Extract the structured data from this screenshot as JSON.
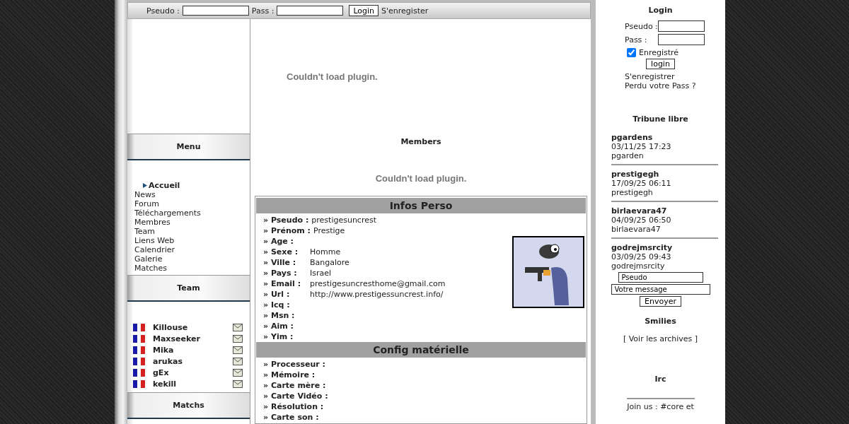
{
  "top_bar": {
    "pseudo_label": "Pseudo :",
    "pass_label": "Pass :",
    "login_button": "Login",
    "register_link": "S'enregister"
  },
  "menu": {
    "title": "Menu",
    "items": [
      {
        "label": "Accueil",
        "selected": true
      },
      {
        "label": "News",
        "selected": false
      },
      {
        "label": "Forum",
        "selected": false
      },
      {
        "label": "Téléchargements",
        "selected": false
      },
      {
        "label": "Membres",
        "selected": false
      },
      {
        "label": "Team",
        "selected": false
      },
      {
        "label": "Liens Web",
        "selected": false
      },
      {
        "label": "Calendrier",
        "selected": false
      },
      {
        "label": "Galerie",
        "selected": false
      },
      {
        "label": "Matches",
        "selected": false
      }
    ]
  },
  "team": {
    "title": "Team",
    "members": [
      {
        "name": "Killouse"
      },
      {
        "name": "Maxseeker"
      },
      {
        "name": "Mika"
      },
      {
        "name": "arukas"
      },
      {
        "name": "gEx"
      },
      {
        "name": "kekill"
      }
    ]
  },
  "matchs": {
    "title": "Matchs"
  },
  "center": {
    "plugin_message_top": "Couldn't load plugin.",
    "members_title": "Members",
    "plugin_message_bottom": "Couldn't load plugin."
  },
  "profile": {
    "sections": [
      {
        "title": "Infos Perso",
        "fields": [
          {
            "label": "» Pseudo :",
            "value": "prestigesuncrest"
          },
          {
            "label": "» Prénom :",
            "value": "Prestige"
          },
          {
            "label": "» Age :"
          },
          {
            "label": "» Sexe :",
            "value": "Homme"
          },
          {
            "label": "» Ville :",
            "value": "Bangalore"
          },
          {
            "label": "» Pays :",
            "value": "Israel"
          },
          {
            "label": "» Email :",
            "value": "prestigesuncresthome@gmail.com"
          },
          {
            "label": "» Url :",
            "value": "http://www.prestigessuncrest.info/"
          },
          {
            "label": "» Icq :"
          },
          {
            "label": "» Msn :"
          },
          {
            "label": "» Aim :"
          },
          {
            "label": "» Yim :"
          }
        ]
      },
      {
        "title": "Config matérielle",
        "fields": [
          {
            "label": "» Processeur :"
          },
          {
            "label": "» Mémoire :"
          },
          {
            "label": "» Carte mère :"
          },
          {
            "label": "» Carte Vidéo :"
          },
          {
            "label": "» Résolution :"
          },
          {
            "label": "» Carte son :"
          }
        ]
      }
    ]
  },
  "login": {
    "title": "Login",
    "pseudo_label": "Pseudo :",
    "pass_label": "Pass :",
    "remember": {
      "label": "Enregistré",
      "checked": true
    },
    "button": "login",
    "links": [
      "S'enregistrer",
      "Perdu votre Pass ?"
    ]
  },
  "tribune": {
    "title": "Tribune libre",
    "posts": [
      {
        "author": "pgardens",
        "date": "03/11/25 17:23",
        "message": "pgarden"
      },
      {
        "author": "prestigegh",
        "date": "17/09/25 06:11",
        "message": "prestigegh"
      },
      {
        "author": "birlaevara47",
        "date": "04/09/25 06:50",
        "message": "birlaevara47"
      },
      {
        "author": "godrejmsrcity",
        "date": "03/09/25 09:43",
        "message": "godrejmsrcity"
      }
    ],
    "pseudo_field": "Pseudo",
    "message_field": "Votre message",
    "send_button": "Envoyer"
  },
  "smilies": {
    "title": "Smilies",
    "archives_link": "[ Voir les archives ]"
  },
  "irc": {
    "title": "Irc",
    "text": "Join us : #core et"
  }
}
